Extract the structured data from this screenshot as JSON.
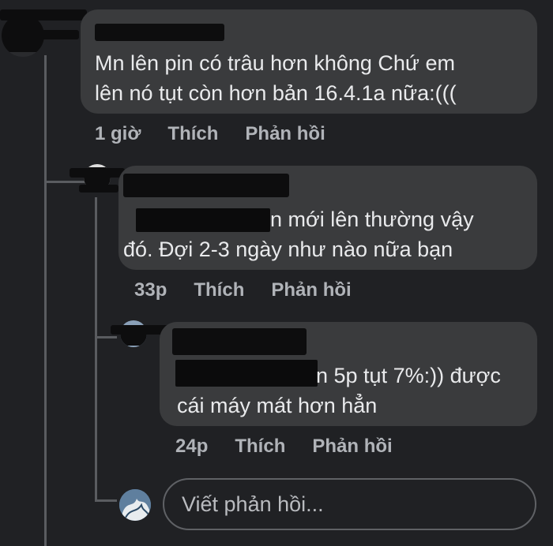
{
  "comment_main": {
    "text_line1": "Mn lên pin có trâu hơn không Chứ em",
    "text_line2": "lên nó tụt còn hơn bản 16.4.1a nữa:(((",
    "time": "1 giờ",
    "like": "Thích",
    "reply": "Phản hồi"
  },
  "reply_1": {
    "text_line1_suffix": "n mới lên thường vậy",
    "text_line2": "đó. Đợi 2-3 ngày như nào nữa bạn",
    "time": "33p",
    "like": "Thích",
    "reply": "Phản hồi"
  },
  "reply_2": {
    "text_line1_suffix": "n 5p tụt 7%:)) được",
    "text_line2": "cái máy mát hơn hẳn",
    "time": "24p",
    "like": "Thích",
    "reply": "Phản hồi"
  },
  "composer": {
    "placeholder": "Viết phản hồi..."
  },
  "colors": {
    "background": "#202124",
    "bubble": "#3a3b3d",
    "meta_text": "#b0b3b8",
    "mention_blue": "#3b82f6"
  }
}
